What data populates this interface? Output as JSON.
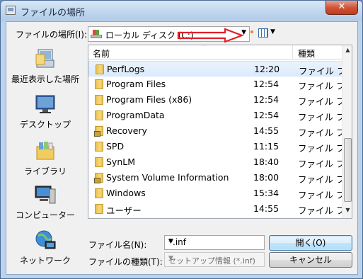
{
  "window": {
    "title": "ファイルの場所",
    "close_label": "✕"
  },
  "toolbar": {
    "lookin_label": "ファイルの場所(I):",
    "lookin_value": "ローカル ディスク (C:)"
  },
  "places": [
    {
      "label": "最近表示した場所",
      "icon": "recent-places-icon"
    },
    {
      "label": "デスクトップ",
      "icon": "desktop-icon"
    },
    {
      "label": "ライブラリ",
      "icon": "libraries-icon"
    },
    {
      "label": "コンピューター",
      "icon": "computer-icon"
    },
    {
      "label": "ネットワーク",
      "icon": "network-icon"
    }
  ],
  "list": {
    "col_name": "名前",
    "col_type": "種類",
    "rows": [
      {
        "name": "PerfLogs",
        "time": "12:20",
        "type": "ファイル フ",
        "locked": false,
        "selected": true
      },
      {
        "name": "Program Files",
        "time": "12:54",
        "type": "ファイル フ",
        "locked": false,
        "selected": false
      },
      {
        "name": "Program Files (x86)",
        "time": "12:54",
        "type": "ファイル フ",
        "locked": false,
        "selected": false
      },
      {
        "name": "ProgramData",
        "time": "12:54",
        "type": "ファイル フ",
        "locked": false,
        "selected": false
      },
      {
        "name": "Recovery",
        "time": "14:55",
        "type": "ファイル フ",
        "locked": true,
        "selected": false
      },
      {
        "name": "SPD",
        "time": "11:15",
        "type": "ファイル フ",
        "locked": false,
        "selected": false
      },
      {
        "name": "SynLM",
        "time": "18:40",
        "type": "ファイル フ",
        "locked": false,
        "selected": false
      },
      {
        "name": "System Volume Information",
        "time": "18:00",
        "type": "ファイル フ",
        "locked": true,
        "selected": false
      },
      {
        "name": "Windows",
        "time": "15:34",
        "type": "ファイル フ",
        "locked": false,
        "selected": false
      },
      {
        "name": "ユーザー",
        "time": "14:55",
        "type": "ファイル フ",
        "locked": false,
        "selected": false
      }
    ]
  },
  "bottom": {
    "filename_label": "ファイル名(N):",
    "filename_value": "*.inf",
    "filetype_label": "ファイルの種類(T):",
    "filetype_value": "セットアップ情報 (*.inf)",
    "open_label": "開く(O)",
    "cancel_label": "キャンセル"
  },
  "colors": {
    "annotation_arrow": "#e0202a",
    "selection": "#dcebfc"
  }
}
